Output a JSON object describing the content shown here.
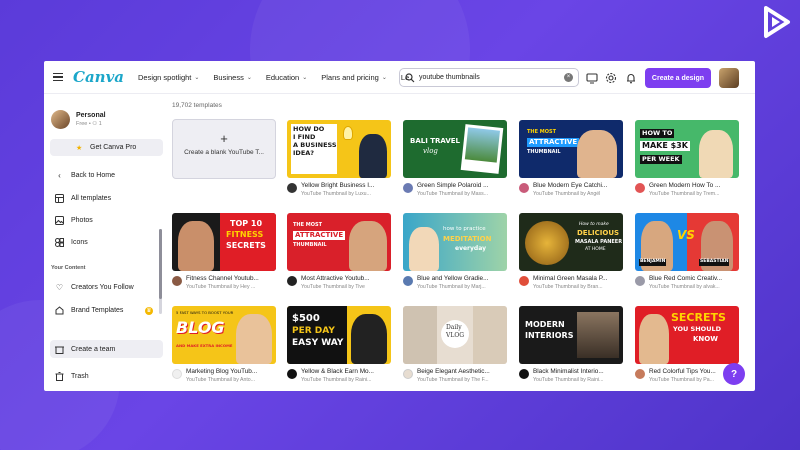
{
  "topbar": {
    "brand": "Canva",
    "nav": [
      "Design spotlight",
      "Business",
      "Education",
      "Plans and pricing",
      "Le"
    ],
    "search_value": "youtube thumbnails",
    "create_label": "Create a design"
  },
  "sidebar": {
    "profile_name": "Personal",
    "profile_plan": "Free • ⚇ 1",
    "pro_label": "Get Canva Pro",
    "back_label": "Back to Home",
    "items": [
      "All templates",
      "Photos",
      "Icons"
    ],
    "section_label": "Your Content",
    "content_items": [
      "Creators You Follow",
      "Brand Templates"
    ],
    "team_label": "Create a team",
    "trash_label": "Trash"
  },
  "main": {
    "count": "19,702 templates",
    "blank_card_label": "Create a blank YouTube T...",
    "templates": [
      {
        "title": "Yellow Bright Business I...",
        "by": "YouTube Thumbnail by Luxu..."
      },
      {
        "title": "Green Simple Polaroid ...",
        "by": "YouTube Thumbnail by Mass..."
      },
      {
        "title": "Blue Modern Eye Catchi...",
        "by": "YouTube Thumbnail by Angél"
      },
      {
        "title": "Green Modern How To ...",
        "by": "YouTube Thumbnail by Trem..."
      },
      {
        "title": "Fitness Channel Youtub...",
        "by": "YouTube Thumbnail by Hey ..."
      },
      {
        "title": "Most Attractive Youtub...",
        "by": "YouTube Thumbnail by Tive"
      },
      {
        "title": "Blue and Yellow Gradie...",
        "by": "YouTube Thumbnail by Marj..."
      },
      {
        "title": "Minimal Green Masala P...",
        "by": "YouTube Thumbnail by Bran..."
      },
      {
        "title": "Blue Red Comic Creativ...",
        "by": "YouTube Thumbnail by alvak..."
      },
      {
        "title": "Marketing Blog YouTub...",
        "by": "YouTube Thumbnail by Anto..."
      },
      {
        "title": "Yellow & Black Earn Mo...",
        "by": "YouTube Thumbnail by Raini..."
      },
      {
        "title": "Beige Elegant Aesthetic...",
        "by": "YouTube Thumbnail by The F..."
      },
      {
        "title": "Black Minimalist Interio...",
        "by": "YouTube Thumbnail by Raini..."
      },
      {
        "title": "Red Colorful Tips You...",
        "by": "YouTube Thumbnail by Pa..."
      }
    ]
  },
  "thumbs": {
    "t0": [
      "HOW DO",
      "I FIND",
      "A BUSINESS",
      "IDEA?"
    ],
    "t1": [
      "BALI TRAVEL",
      "vlog"
    ],
    "t2": [
      "THE MOST",
      "ATTRACTIVE",
      "THUMBNAIL"
    ],
    "t3": [
      "HOW TO",
      "MAKE $3K",
      "PER WEEK"
    ],
    "t4": [
      "TOP 10",
      "FITNESS",
      "SECRETS"
    ],
    "t5": [
      "THE MOST",
      "ATTRACTIVE",
      "THUMBNAIL"
    ],
    "t6": [
      "how to practice",
      "MEDITATION",
      "everyday"
    ],
    "t7": [
      "How to make",
      "DELICIOUS",
      "MASALA PANEER",
      "AT HOME"
    ],
    "t8": [
      "VS",
      "BENJAMIN",
      "SEBASTIAN"
    ],
    "t9": [
      "5 FAST WAYS TO BOOST YOUR",
      "BLOG",
      "AND MAKE EXTRA INCOME"
    ],
    "t10": [
      "$500",
      "PER DAY",
      "EASY WAY"
    ],
    "t11": [
      "Daily",
      "VLOG"
    ],
    "t12": [
      "MODERN",
      "INTERIORS"
    ],
    "t13": [
      "SECRETS",
      "YOU SHOULD",
      "KNOW"
    ]
  },
  "help_label": "?",
  "colors": {
    "accent": "#7d3ef0",
    "brand": "#1ba6c9",
    "background": "#5b3bd9"
  }
}
